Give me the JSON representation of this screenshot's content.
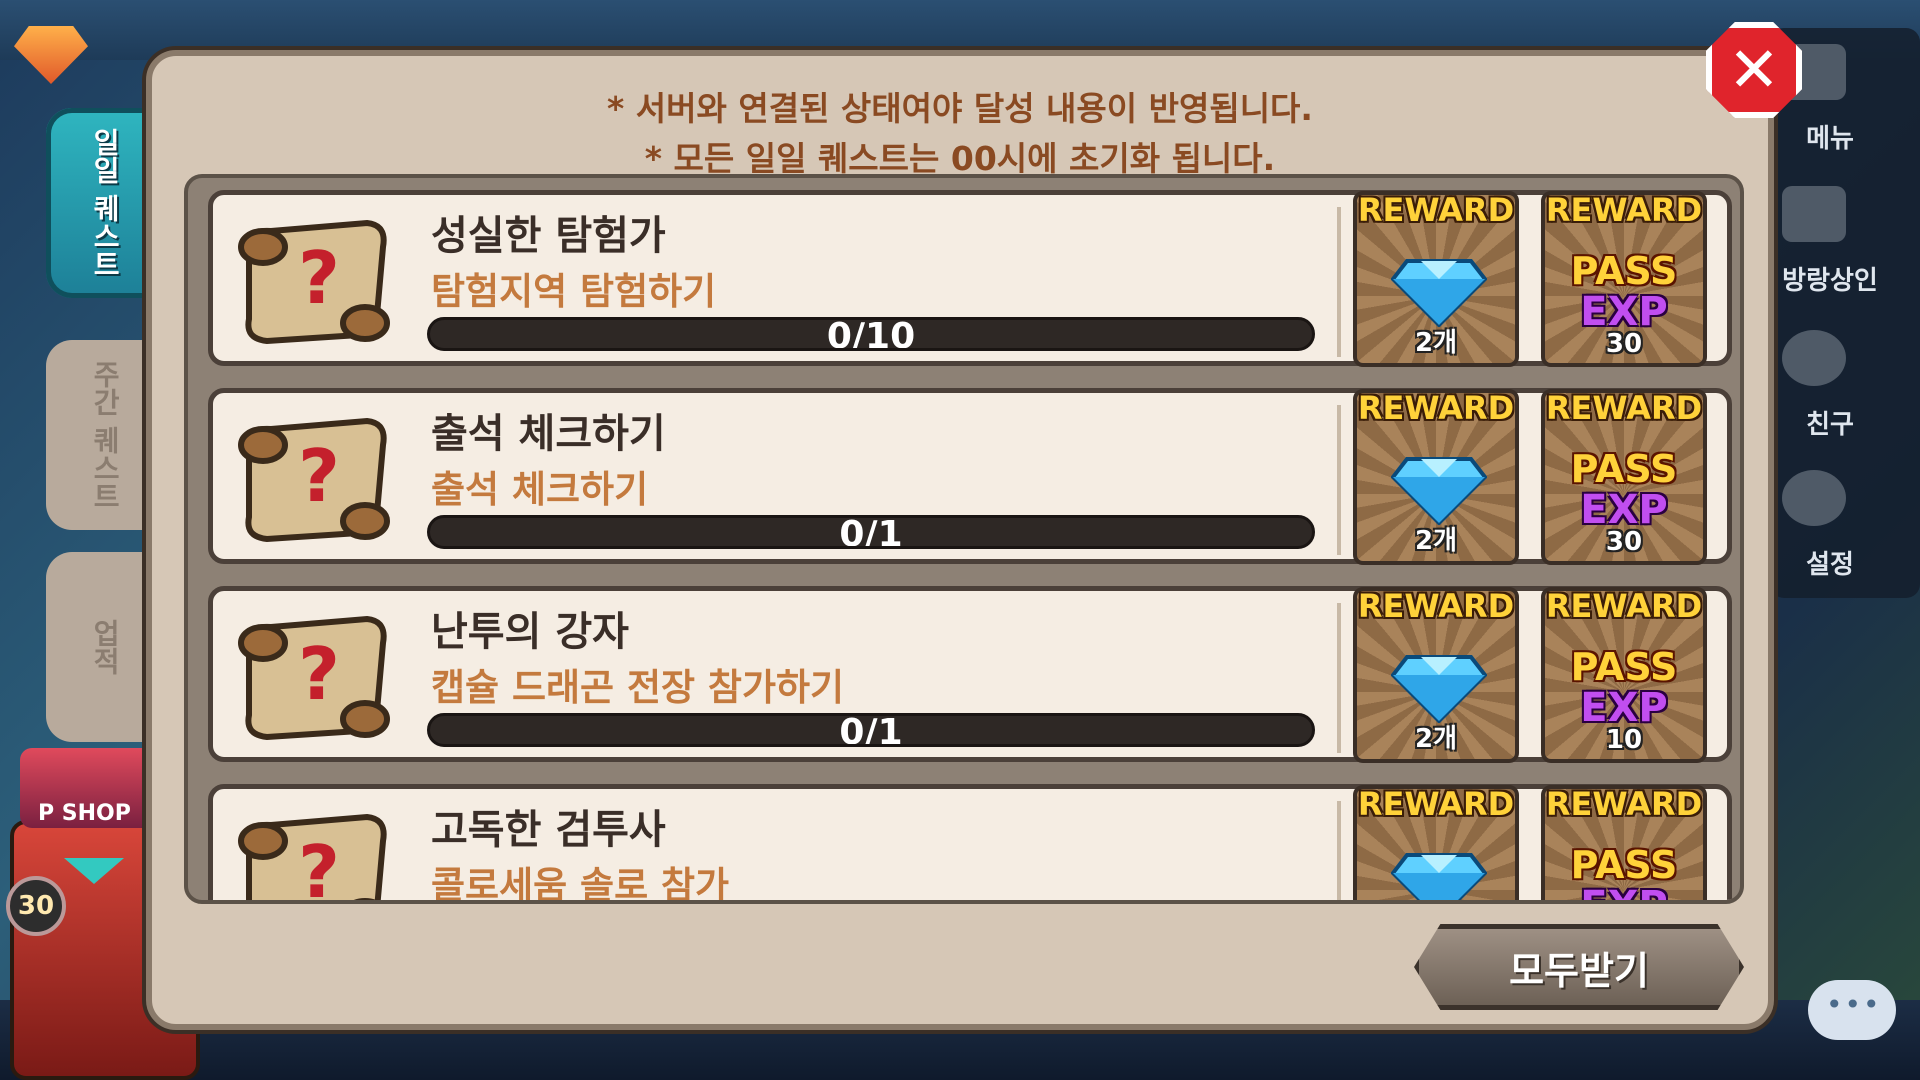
{
  "notices": [
    "* 서버와 연결된 상태여야 달성 내용이 반영됩니다.",
    "* 모든 일일 퀘스트는 00시에 초기화 됩니다."
  ],
  "tabs": {
    "daily": "일일 퀘스트",
    "weekly": "주간 퀘스트",
    "achievement": "업적"
  },
  "side_menu": {
    "menu": "메뉴",
    "merchant": "방랑상인",
    "friends": "친구",
    "settings": "설정"
  },
  "level_badge": "30",
  "pshop_label": "P SHOP",
  "quests": [
    {
      "title": "성실한 탐험가",
      "desc": "탐험지역 탐험하기",
      "progress": "0/10",
      "progress_fraction": 0,
      "reward1": {
        "label": "REWARD",
        "count": "2개"
      },
      "reward2": {
        "label": "REWARD",
        "pass": "PASS",
        "exp": "EXP",
        "amount": "30"
      }
    },
    {
      "title": "출석 체크하기",
      "desc": "출석 체크하기",
      "progress": "0/1",
      "progress_fraction": 0,
      "reward1": {
        "label": "REWARD",
        "count": "2개"
      },
      "reward2": {
        "label": "REWARD",
        "pass": "PASS",
        "exp": "EXP",
        "amount": "30"
      }
    },
    {
      "title": "난투의 강자",
      "desc": "캡슐 드래곤 전장 참가하기",
      "progress": "0/1",
      "progress_fraction": 0,
      "reward1": {
        "label": "REWARD",
        "count": "2개"
      },
      "reward2": {
        "label": "REWARD",
        "pass": "PASS",
        "exp": "EXP",
        "amount": "10"
      }
    },
    {
      "title": "고독한 검투사",
      "desc": "콜로세움 솔로 참가",
      "progress": "",
      "progress_fraction": 0,
      "reward1": {
        "label": "REWARD",
        "count": ""
      },
      "reward2": {
        "label": "REWARD",
        "pass": "PASS",
        "exp": "EXP",
        "amount": ""
      }
    }
  ],
  "close_label": "✕",
  "receive_all": "모두받기",
  "colors": {
    "accent": "#c47a3e",
    "panel": "#d6c7b6",
    "close": "#e0242c",
    "reward_gold": "#ffd23a"
  }
}
